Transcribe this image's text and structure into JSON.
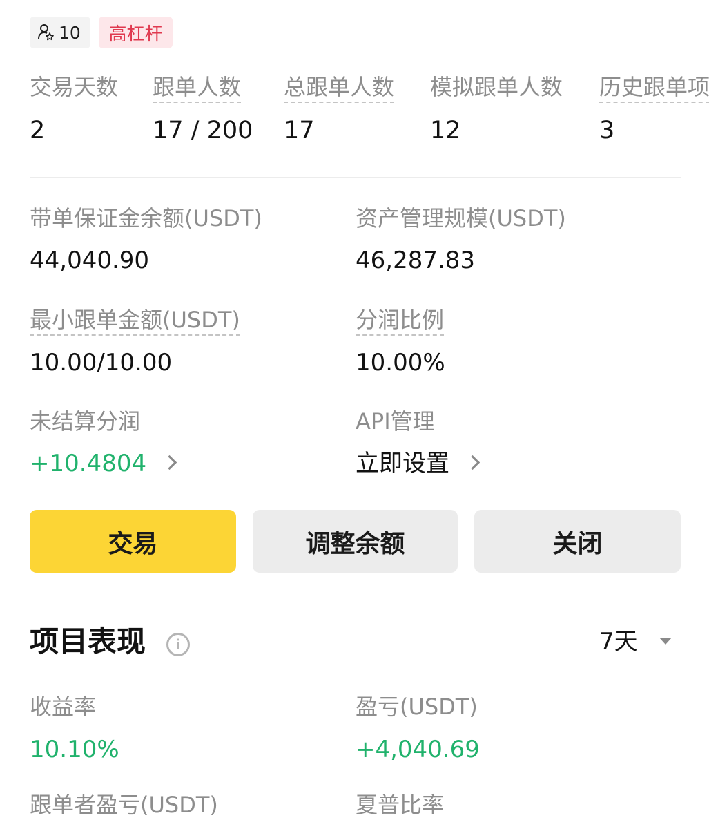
{
  "tags": {
    "followers_count": "10",
    "leverage": "高杠杆"
  },
  "stats": [
    {
      "label": "交易天数",
      "value": "2"
    },
    {
      "label": "跟单人数",
      "value": "17 / 200"
    },
    {
      "label": "总跟单人数",
      "value": "17"
    },
    {
      "label": "模拟跟单人数",
      "value": "12"
    },
    {
      "label": "历史跟单项",
      "value": "3"
    }
  ],
  "account": {
    "margin_balance_label": "带单保证金余额(USDT)",
    "margin_balance_value": "44,040.90",
    "aum_label": "资产管理规模(USDT)",
    "aum_value": "46,287.83",
    "min_copy_label": "最小跟单金额(USDT)",
    "min_copy_value": "10.00/10.00",
    "profit_share_label": "分润比例",
    "profit_share_value": "10.00%",
    "unsettled_label": "未结算分润",
    "unsettled_value": "+10.4804",
    "api_label": "API管理",
    "api_value": "立即设置"
  },
  "buttons": {
    "trade": "交易",
    "adjust_balance": "调整余额",
    "close": "关闭"
  },
  "performance": {
    "title": "项目表现",
    "period": "7天",
    "roi_label": "收益率",
    "roi_value": "10.10%",
    "pnl_label": "盈亏(USDT)",
    "pnl_value": "+4,040.69",
    "follower_pnl_label": "跟单者盈亏(USDT)",
    "sharpe_label": "夏普比率"
  },
  "colors": {
    "positive": "#20b26c",
    "accent": "#fcd535",
    "leverage_tag": "#e0394f"
  },
  "icons": {
    "followers": "user-star-icon",
    "info": "info-icon",
    "chevron": "chevron-right-icon",
    "dropdown": "caret-down-icon"
  }
}
